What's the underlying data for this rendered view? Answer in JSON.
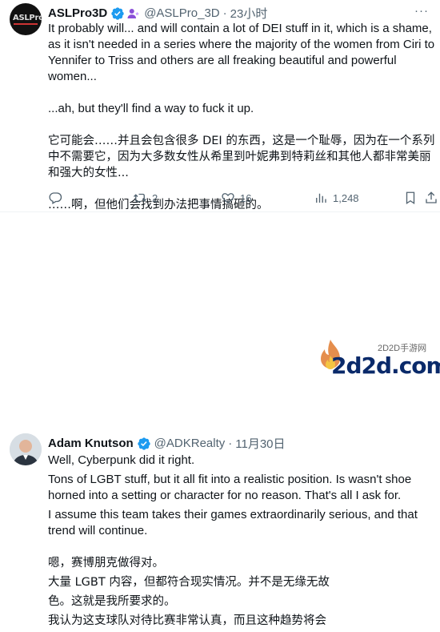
{
  "tweet1": {
    "display_name": "ASLPro3D",
    "handle": "@ASLPro_3D",
    "separator": "·",
    "time": "23小时",
    "avatar_text": "ASLPro",
    "more": "···",
    "paragraphs": [
      "It probably will... and will contain a lot of DEI stuff in it, which is a shame, as it isn't needed in a series where the majority of the women from Ciri to Yennifer to Triss and others are all freaking beautiful and powerful women...",
      "...ah, but they'll find a way to fuck it up.",
      "它可能会……并且会包含很多 DEI 的东西，这是一个耻辱，因为在一个系列中不需要它，因为大多数女性从希里到叶妮弗到特莉丝和其他人都非常美丽和强大的女性...",
      "……啊，但他们会找到办法把事情搞砸的。"
    ],
    "actions": {
      "replies": "",
      "retweets": "2",
      "likes": "16",
      "views": "1,248"
    }
  },
  "tweet2": {
    "display_name": "Adam Knutson",
    "handle": "@ADKRealty",
    "separator": "·",
    "time": "11月30日",
    "lines": [
      "Well, Cyberpunk did it right.",
      "Tons of LGBT stuff, but it all fit into a realistic position. Is wasn't shoe horned into a setting or character for no reason. That's all I ask for.",
      "I assume this team takes their games extraordinarily serious, and that trend will continue."
    ],
    "translation": [
      "嗯，赛博朋克做得对。",
      "大量 LGBT 内容，但都符合现实情况。并不是无缘无故",
      "色。这就是我所要求的。",
      "我认为这支球队对待比赛非常认真，而且这种趋势将会"
    ]
  },
  "watermark": {
    "sub": "2D2D手游网",
    "main": "2d2d.com"
  },
  "colors": {
    "text": "#0f1419",
    "muted": "#536471",
    "verified_blue": "#1d9bf0",
    "affiliate": "#8a4fd8"
  }
}
